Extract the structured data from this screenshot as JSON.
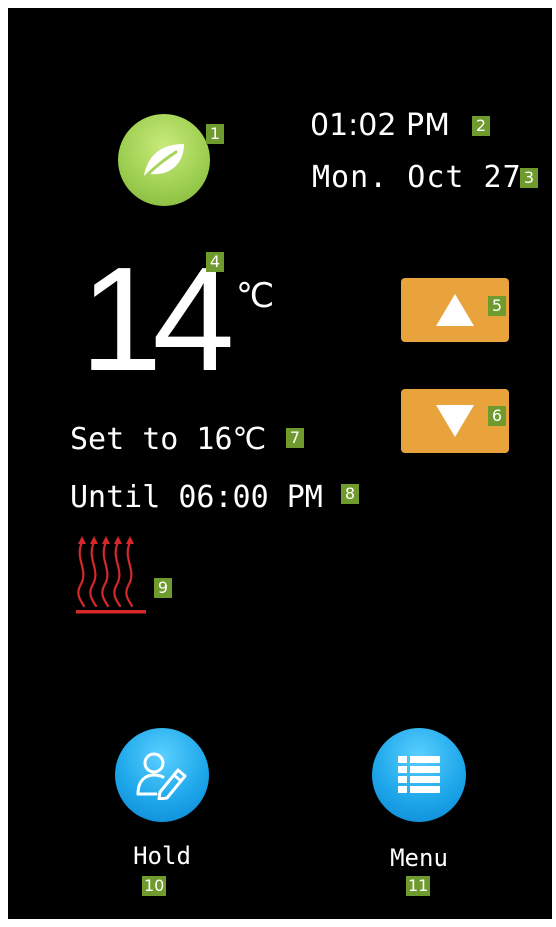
{
  "status": {
    "time": "01:02 PM",
    "date": "Mon. Oct 27"
  },
  "temperature": {
    "current": "14",
    "unit": "℃",
    "setpoint_text": "Set to 16℃",
    "until_text": "Until 06:00 PM"
  },
  "buttons": {
    "hold_label": "Hold",
    "menu_label": "Menu"
  },
  "badges": {
    "b1": "1",
    "b2": "2",
    "b3": "3",
    "b4": "4",
    "b5": "5",
    "b6": "6",
    "b7": "7",
    "b8": "8",
    "b9": "9",
    "b10": "10",
    "b11": "11"
  },
  "icons": {
    "eco": "leaf-icon",
    "up": "triangle-up-icon",
    "down": "triangle-down-icon",
    "heat": "heating-icon",
    "hold": "user-edit-icon",
    "menu": "list-menu-icon"
  },
  "colors": {
    "background": "#000000",
    "text": "#ffffff",
    "eco_green": "#9fd052",
    "arrow_orange": "#e8a33c",
    "action_blue": "#1ea7ea",
    "heat_red": "#d62828",
    "badge_green": "#6f9a2e"
  }
}
